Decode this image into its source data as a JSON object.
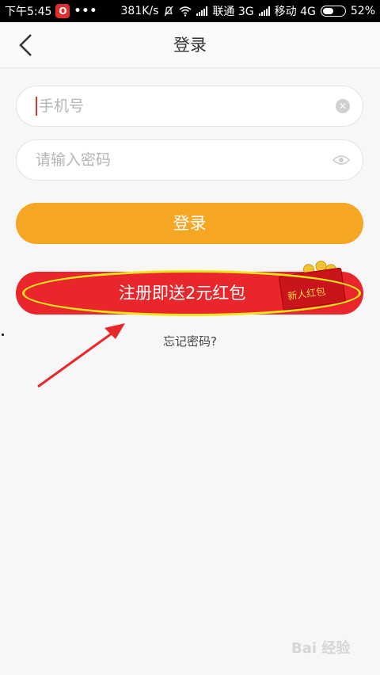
{
  "status_bar": {
    "time": "下午5:45",
    "app_badge": "O",
    "more": "•••",
    "speed": "381K/s",
    "carrier1": "联通 3G",
    "carrier2": "移动 4G",
    "battery": "52%",
    "battery_level": 0.52
  },
  "header": {
    "title": "登录"
  },
  "form": {
    "phone_placeholder": "手机号",
    "phone_value": "",
    "password_placeholder": "请输入密码",
    "password_value": ""
  },
  "buttons": {
    "login_label": "登录",
    "register_label": "注册即送2元红包",
    "register_badge_text": "新人红包"
  },
  "links": {
    "forgot_password": "忘记密码?"
  },
  "watermark": "Bai 经验",
  "colors": {
    "login_button": "#f5a623",
    "register_button": "#e8262b",
    "annotation": "#e8262b",
    "highlight": "#f4e41e"
  }
}
